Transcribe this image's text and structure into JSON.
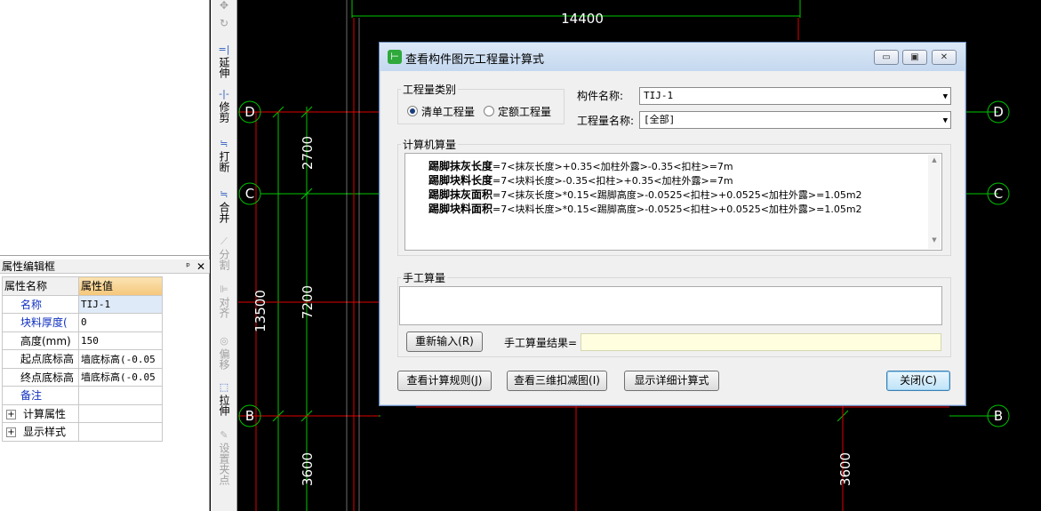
{
  "left_panel": {
    "title": "属性编辑框",
    "pin_icon": "pin-icon",
    "header": {
      "name_col": "属性名称",
      "value_col": "属性值"
    },
    "rows": [
      {
        "name": "名称",
        "value": "TIJ-1"
      },
      {
        "name": "块料厚度(",
        "value": "0"
      },
      {
        "name": "高度(mm)",
        "value": "150"
      },
      {
        "name": "起点底标高",
        "value": "墙底标高(-0.05"
      },
      {
        "name": "终点底标高",
        "value": "墙底标高(-0.05"
      },
      {
        "name": "备注",
        "value": ""
      },
      {
        "name": "计算属性",
        "value": ""
      },
      {
        "name": "显示样式",
        "value": ""
      }
    ],
    "expand_symbol": "+"
  },
  "toolbar": {
    "items": [
      {
        "label": "延伸",
        "icon": "extend-icon",
        "glyph": "=|"
      },
      {
        "label": "修剪",
        "icon": "trim-icon",
        "glyph": "-|-"
      },
      {
        "label": "打断",
        "icon": "break-icon",
        "glyph": "≒"
      },
      {
        "label": "合并",
        "icon": "merge-icon",
        "glyph": "≒"
      },
      {
        "label": "分割",
        "icon": "split-icon",
        "glyph": "⟋"
      },
      {
        "label": "对齐",
        "icon": "align-icon",
        "glyph": "⊫"
      },
      {
        "label": "偏移",
        "icon": "offset-icon",
        "glyph": "◎"
      },
      {
        "label": "拉伸",
        "icon": "stretch-icon",
        "glyph": "⬚"
      },
      {
        "label": "设置夹点",
        "icon": "set-grip-icon",
        "glyph": "✎"
      }
    ]
  },
  "cad": {
    "dims": {
      "top": "14400",
      "d_c": "2700",
      "c_b": "7200",
      "total": "13500",
      "bottom_left": "3600",
      "bottom_right": "3600"
    },
    "axes": {
      "d": "D",
      "c": "C",
      "b": "B"
    },
    "colors": {
      "grid_green": "#00d000",
      "wall_red": "#e00000",
      "text": "#ffffff",
      "circle": "#00c000"
    }
  },
  "dialog": {
    "title": "查看构件图元工程量计算式",
    "min_label": "▭",
    "max_label": "▣",
    "close_label": "✕",
    "qty_type_group": "工程量类别",
    "radio_list": "清单工程量",
    "radio_quota": "定额工程量",
    "component_name_label": "构件名称:",
    "component_name_value": "TIJ-1",
    "qty_name_label": "工程量名称:",
    "qty_name_value": "[全部]",
    "machine_group": "计算机算量",
    "calc_lines": [
      {
        "key": "踢脚抹灰长度",
        "expr": "=7<抹灰长度>+0.35<加柱外露>-0.35<扣柱>=7m"
      },
      {
        "key": "踢脚块料长度",
        "expr": "=7<块料长度>-0.35<扣柱>+0.35<加柱外露>=7m"
      },
      {
        "key": "踢脚抹灰面积",
        "expr": "=7<抹灰长度>*0.15<踢脚高度>-0.0525<扣柱>+0.0525<加柱外露>=1.05m2"
      },
      {
        "key": "踢脚块料面积",
        "expr": "=7<块料长度>*0.15<踢脚高度>-0.0525<扣柱>+0.0525<加柱外露>=1.05m2"
      }
    ],
    "manual_group": "手工算量",
    "reenter_button": "重新输入(R)",
    "manual_result_label": "手工算量结果=",
    "manual_result_value": "",
    "view_rules_button": "查看计算规则(J)",
    "view_3d_button": "查看三维扣减图(I)",
    "show_detail_button": "显示详细计算式",
    "close_button": "关闭(C)"
  }
}
